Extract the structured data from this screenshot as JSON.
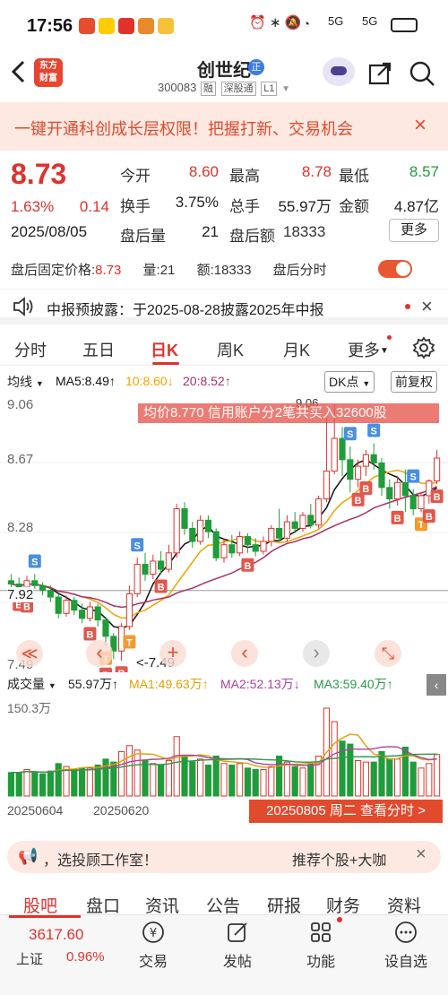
{
  "status_bar": {
    "time": "17:56",
    "network": "5G",
    "battery": "battery-icon"
  },
  "header": {
    "back": "back-arrow-icon",
    "logo_line1": "东方",
    "logo_line2": "财富",
    "title": "创世纪",
    "badge": "正",
    "code": "300083",
    "tag1": "融",
    "tag2": "深股通",
    "tag3": "L1"
  },
  "banner": {
    "text": "一键开通科创成长层权限！把握打新、交易机会",
    "close": "×"
  },
  "quote": {
    "price": "8.73",
    "change_pct": "1.63%",
    "change": "0.14",
    "date": "2025/08/05",
    "open_label": "今开",
    "open": "8.60",
    "high_label": "最高",
    "high": "8.78",
    "low_label": "最低",
    "low": "8.57",
    "turnover_label": "换手",
    "turnover": "3.75%",
    "volume_label": "总手",
    "volume": "55.97万",
    "amount_label": "金额",
    "amount": "4.87亿",
    "ah_vol_label": "盘后量",
    "ah_vol": "21",
    "ah_amt_label": "盘后额",
    "ah_amt": "18333",
    "more": "更多"
  },
  "after_hours": {
    "price_label": "盘后固定价格:",
    "price": "8.73",
    "vol_label": "量:",
    "vol": "21",
    "amt_label": "额:",
    "amt": "18333",
    "tick_label": "盘后分时"
  },
  "notice": {
    "text": "中报预披露：于2025-08-28披露2025年中报",
    "close": "×"
  },
  "tabs": [
    "分时",
    "五日",
    "日K",
    "周K",
    "月K",
    "更多"
  ],
  "ma_row": {
    "selector": "均线",
    "ma5": "MA5:8.49↑",
    "ma10": "10:8.60↓",
    "ma20": "20:8.52↑",
    "dk": "DK点",
    "adjust": "前复权"
  },
  "chart_data": {
    "type": "candlestick",
    "y_ticks": [
      "9.06",
      "8.67",
      "8.28"
    ],
    "y_low_label": "7.49",
    "ref_label": "7.92",
    "y_max_label": "9.06",
    "min_annotation": "<-7.49",
    "tooltip": "均价8.770  信用账户分2笔共买入32600股",
    "ylim": [
      7.42,
      9.13
    ],
    "candles": [
      [
        7.98,
        7.96,
        8.02,
        7.93
      ],
      [
        7.96,
        7.94,
        8.0,
        7.91
      ],
      [
        7.94,
        7.98,
        8.01,
        7.9
      ],
      [
        7.98,
        7.95,
        8.02,
        7.93
      ],
      [
        7.95,
        7.92,
        7.97,
        7.89
      ],
      [
        7.92,
        7.88,
        7.95,
        7.85
      ],
      [
        7.88,
        7.78,
        7.9,
        7.75
      ],
      [
        7.78,
        7.86,
        7.89,
        7.76
      ],
      [
        7.86,
        7.8,
        7.88,
        7.77
      ],
      [
        7.8,
        7.75,
        7.84,
        7.72
      ],
      [
        7.75,
        7.82,
        7.85,
        7.73
      ],
      [
        7.82,
        7.74,
        7.84,
        7.7
      ],
      [
        7.74,
        7.64,
        7.76,
        7.58
      ],
      [
        7.64,
        7.55,
        7.66,
        7.5
      ],
      [
        7.55,
        7.7,
        7.72,
        7.49
      ],
      [
        7.7,
        7.9,
        7.95,
        7.68
      ],
      [
        7.9,
        8.08,
        8.12,
        7.88
      ],
      [
        8.08,
        8.02,
        8.15,
        7.98
      ],
      [
        8.02,
        8.1,
        8.14,
        7.99
      ],
      [
        8.1,
        8.05,
        8.16,
        8.02
      ],
      [
        8.05,
        8.15,
        8.2,
        8.03
      ],
      [
        8.15,
        8.42,
        8.45,
        8.12
      ],
      [
        8.42,
        8.3,
        8.46,
        8.26
      ],
      [
        8.3,
        8.22,
        8.34,
        8.18
      ],
      [
        8.22,
        8.35,
        8.38,
        8.2
      ],
      [
        8.35,
        8.28,
        8.38,
        8.24
      ],
      [
        8.28,
        8.12,
        8.3,
        8.1
      ],
      [
        8.12,
        8.2,
        8.24,
        8.09
      ],
      [
        8.2,
        8.15,
        8.26,
        8.12
      ],
      [
        8.15,
        8.25,
        8.28,
        8.13
      ],
      [
        8.25,
        8.2,
        8.27,
        8.15
      ],
      [
        8.2,
        8.16,
        8.24,
        8.13
      ],
      [
        8.16,
        8.22,
        8.25,
        8.14
      ],
      [
        8.22,
        8.3,
        8.32,
        8.19
      ],
      [
        8.3,
        8.24,
        8.42,
        8.22
      ],
      [
        8.24,
        8.34,
        8.38,
        8.22
      ],
      [
        8.34,
        8.3,
        8.4,
        8.27
      ],
      [
        8.3,
        8.38,
        8.4,
        8.28
      ],
      [
        8.38,
        8.32,
        8.45,
        8.3
      ],
      [
        8.32,
        8.48,
        8.5,
        8.3
      ],
      [
        8.48,
        8.65,
        8.98,
        8.46
      ],
      [
        8.65,
        8.85,
        9.06,
        8.63
      ],
      [
        8.85,
        8.72,
        8.92,
        8.62
      ],
      [
        8.72,
        8.6,
        8.8,
        8.52
      ],
      [
        8.6,
        8.68,
        8.72,
        8.55
      ],
      [
        8.68,
        8.75,
        8.78,
        8.62
      ],
      [
        8.75,
        8.7,
        8.82,
        8.66
      ],
      [
        8.7,
        8.55,
        8.73,
        8.5
      ],
      [
        8.55,
        8.48,
        8.6,
        8.42
      ],
      [
        8.48,
        8.58,
        8.62,
        8.44
      ],
      [
        8.58,
        8.5,
        8.66,
        8.4
      ],
      [
        8.5,
        8.42,
        8.54,
        8.38
      ],
      [
        8.42,
        8.5,
        8.52,
        8.4
      ],
      [
        8.5,
        8.59,
        8.6,
        8.45
      ],
      [
        8.59,
        8.73,
        8.78,
        8.57
      ]
    ],
    "signals": [
      {
        "i": 1,
        "t": "B"
      },
      {
        "i": 2,
        "t": "B"
      },
      {
        "i": 10,
        "t": "B"
      },
      {
        "i": 12,
        "t": "T"
      },
      {
        "i": 12,
        "t": "B"
      },
      {
        "i": 14,
        "t": "B"
      },
      {
        "i": 15,
        "t": "T"
      },
      {
        "i": 16,
        "t": "S"
      },
      {
        "i": 19,
        "t": "B"
      },
      {
        "i": 30,
        "t": "B"
      },
      {
        "i": 43,
        "t": "S"
      },
      {
        "i": 44,
        "t": "B"
      },
      {
        "i": 45,
        "t": "B"
      },
      {
        "i": 46,
        "t": "S"
      },
      {
        "i": 49,
        "t": "B"
      },
      {
        "i": 51,
        "t": "S"
      },
      {
        "i": 52,
        "t": "T"
      },
      {
        "i": 53,
        "t": "B"
      },
      {
        "i": 54,
        "t": "B"
      },
      {
        "i": 3,
        "t": "S"
      }
    ]
  },
  "nav_arrows": [
    "≪",
    "‹",
    "+",
    "‹",
    "›",
    "⤡"
  ],
  "volume_row": {
    "label": "成交量",
    "vol": "55.97万↑",
    "ma1": "MA1:49.63万↑",
    "ma2": "MA2:52.13万↓",
    "ma3": "MA3:59.40万↑",
    "y_top": "150.3万",
    "date1": "20250604",
    "date2": "20250620",
    "date_btn": "20250805 周二 查看分时 >"
  },
  "ad": {
    "left": "，选投顾工作室！",
    "right": "推荐个股+大咖",
    "close": "×"
  },
  "bottom_tabs": [
    "股吧",
    "盘口",
    "资讯",
    "公告",
    "研报",
    "财务",
    "资料"
  ],
  "nav": {
    "index_value": "3617.60",
    "index_name": "上证",
    "index_pct": "0.96%",
    "items": [
      "交易",
      "发帖",
      "功能",
      "设自选"
    ]
  },
  "colors": {
    "up": "#e0322d",
    "down": "#1f9d3a",
    "ma5": "#111111",
    "ma10": "#f0a400",
    "ma20": "#a8306b",
    "buy_signal": "#e2574c",
    "sell_signal": "#4a8fe0",
    "t_signal": "#f29b2e"
  }
}
